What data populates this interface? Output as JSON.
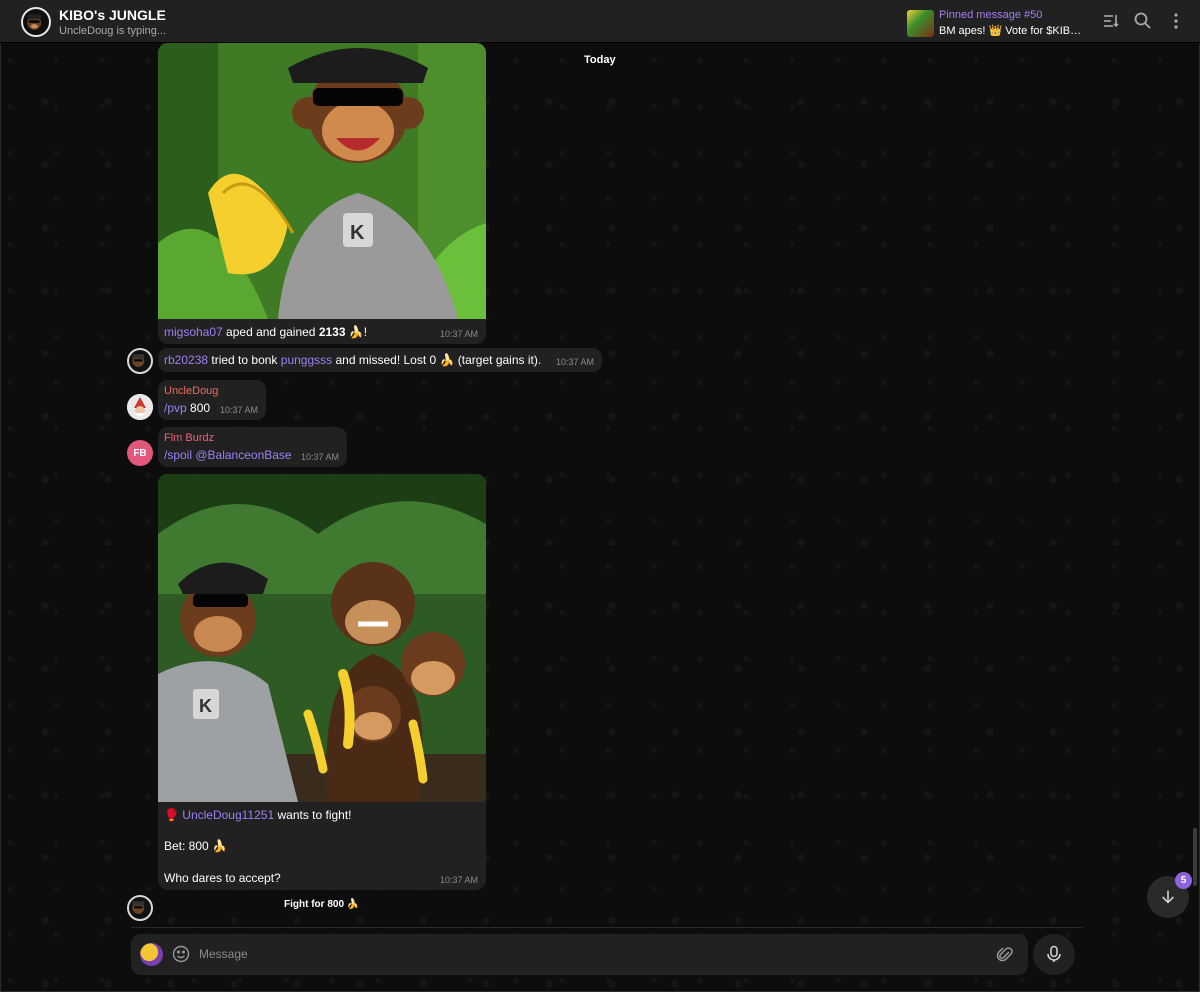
{
  "header": {
    "title": "KIBO's JUNGLE",
    "status": "UncleDoug is typing...",
    "pinned_title": "Pinned message #50",
    "pinned_text": "BM apes! 👑 Vote for $KIBO o..."
  },
  "date_chip": "Today",
  "messages": {
    "m1": {
      "user": "migsoha07",
      "text_mid": " aped and gained ",
      "amount": "2133",
      "text_end": " 🍌!",
      "time": "10:37 AM"
    },
    "m2": {
      "user": "rb20238",
      "text1": " tried to bonk ",
      "target": "punggsss",
      "text2": " and missed! Lost 0 🍌 (target gains it).",
      "time": "10:37 AM"
    },
    "m3": {
      "sender": "UncleDoug",
      "command": "/pvp",
      "arg": " 800",
      "time": "10:37 AM"
    },
    "m4": {
      "sender": "Flm Burdz",
      "avatar_initials": "FB",
      "command": "/spoil @BalanceonBase",
      "time": "10:37 AM"
    },
    "m5": {
      "prefix": "🥊 ",
      "user": "UncleDoug11251",
      "line1_end": " wants to fight!",
      "line2": "Bet: 800 🍌",
      "line3": "Who dares to accept?",
      "time": "10:37 AM"
    },
    "m6": {
      "text": "Fight for 800 🍌"
    }
  },
  "composer": {
    "placeholder": "Message"
  },
  "scroll_badge": "5",
  "colors": {
    "accent": "#a07ff1",
    "bubble": "#212121",
    "background": "#0e0e0e"
  },
  "icons": [
    "sort-icon",
    "search-icon",
    "more-vertical-icon",
    "emoji-icon",
    "attach-icon",
    "mic-icon",
    "arrow-down-icon"
  ]
}
